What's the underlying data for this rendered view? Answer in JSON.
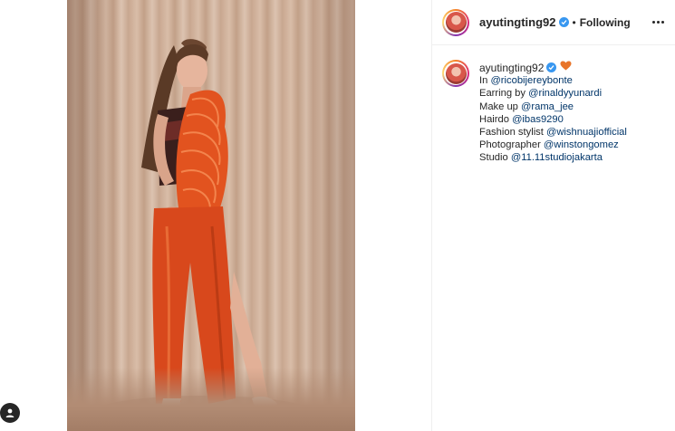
{
  "post": {
    "username": "ayutingting92",
    "follow_dot": "•",
    "follow_status": "Following"
  },
  "caption": {
    "username": "ayutingting92",
    "lines": [
      {
        "prefix": "In ",
        "mention": "@ricobijereybonte"
      },
      {
        "prefix": "Earring by ",
        "mention": "@rinaldyyunardi"
      },
      {
        "prefix": "Make up ",
        "mention": "@rama_jee"
      },
      {
        "prefix": "Hairdo ",
        "mention": "@ibas9290"
      },
      {
        "prefix": "Fashion stylist ",
        "mention": "@wishnuajiofficial"
      },
      {
        "prefix": "Photographer ",
        "mention": "@winstongomez"
      },
      {
        "prefix": "Studio ",
        "mention": "@11.11studiojakarta"
      }
    ]
  },
  "icons": {
    "verified": "verified-badge-icon",
    "heart": "orange-heart-icon",
    "more": "more-options-icon",
    "user": "user-icon"
  },
  "colors": {
    "verified_blue": "#3897f0",
    "mention_blue": "#003569",
    "heart_orange": "#e8752a",
    "divider": "#efefef"
  }
}
